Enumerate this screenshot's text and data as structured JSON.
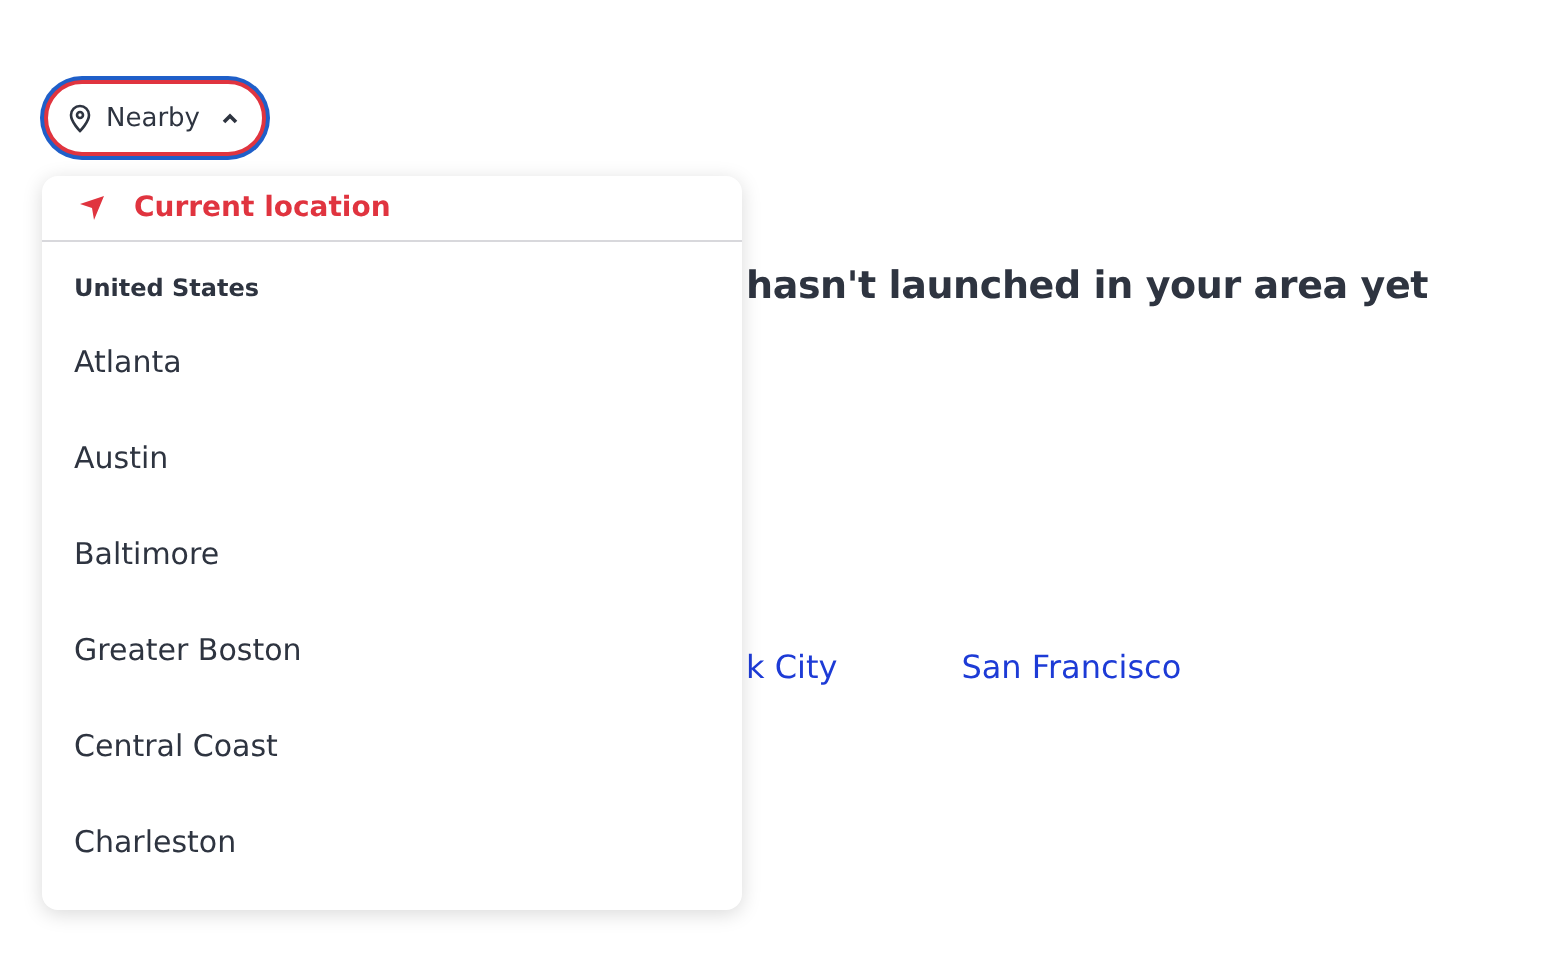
{
  "location_button": {
    "label": "Nearby",
    "expanded": true
  },
  "background": {
    "heading": "hasn't launched in your area yet",
    "links": [
      "k City",
      "San Francisco"
    ]
  },
  "menu": {
    "current_location": "Current location",
    "group": "United States",
    "items": [
      "Atlanta",
      "Austin",
      "Baltimore",
      "Greater Boston",
      "Central Coast",
      "Charleston"
    ]
  }
}
